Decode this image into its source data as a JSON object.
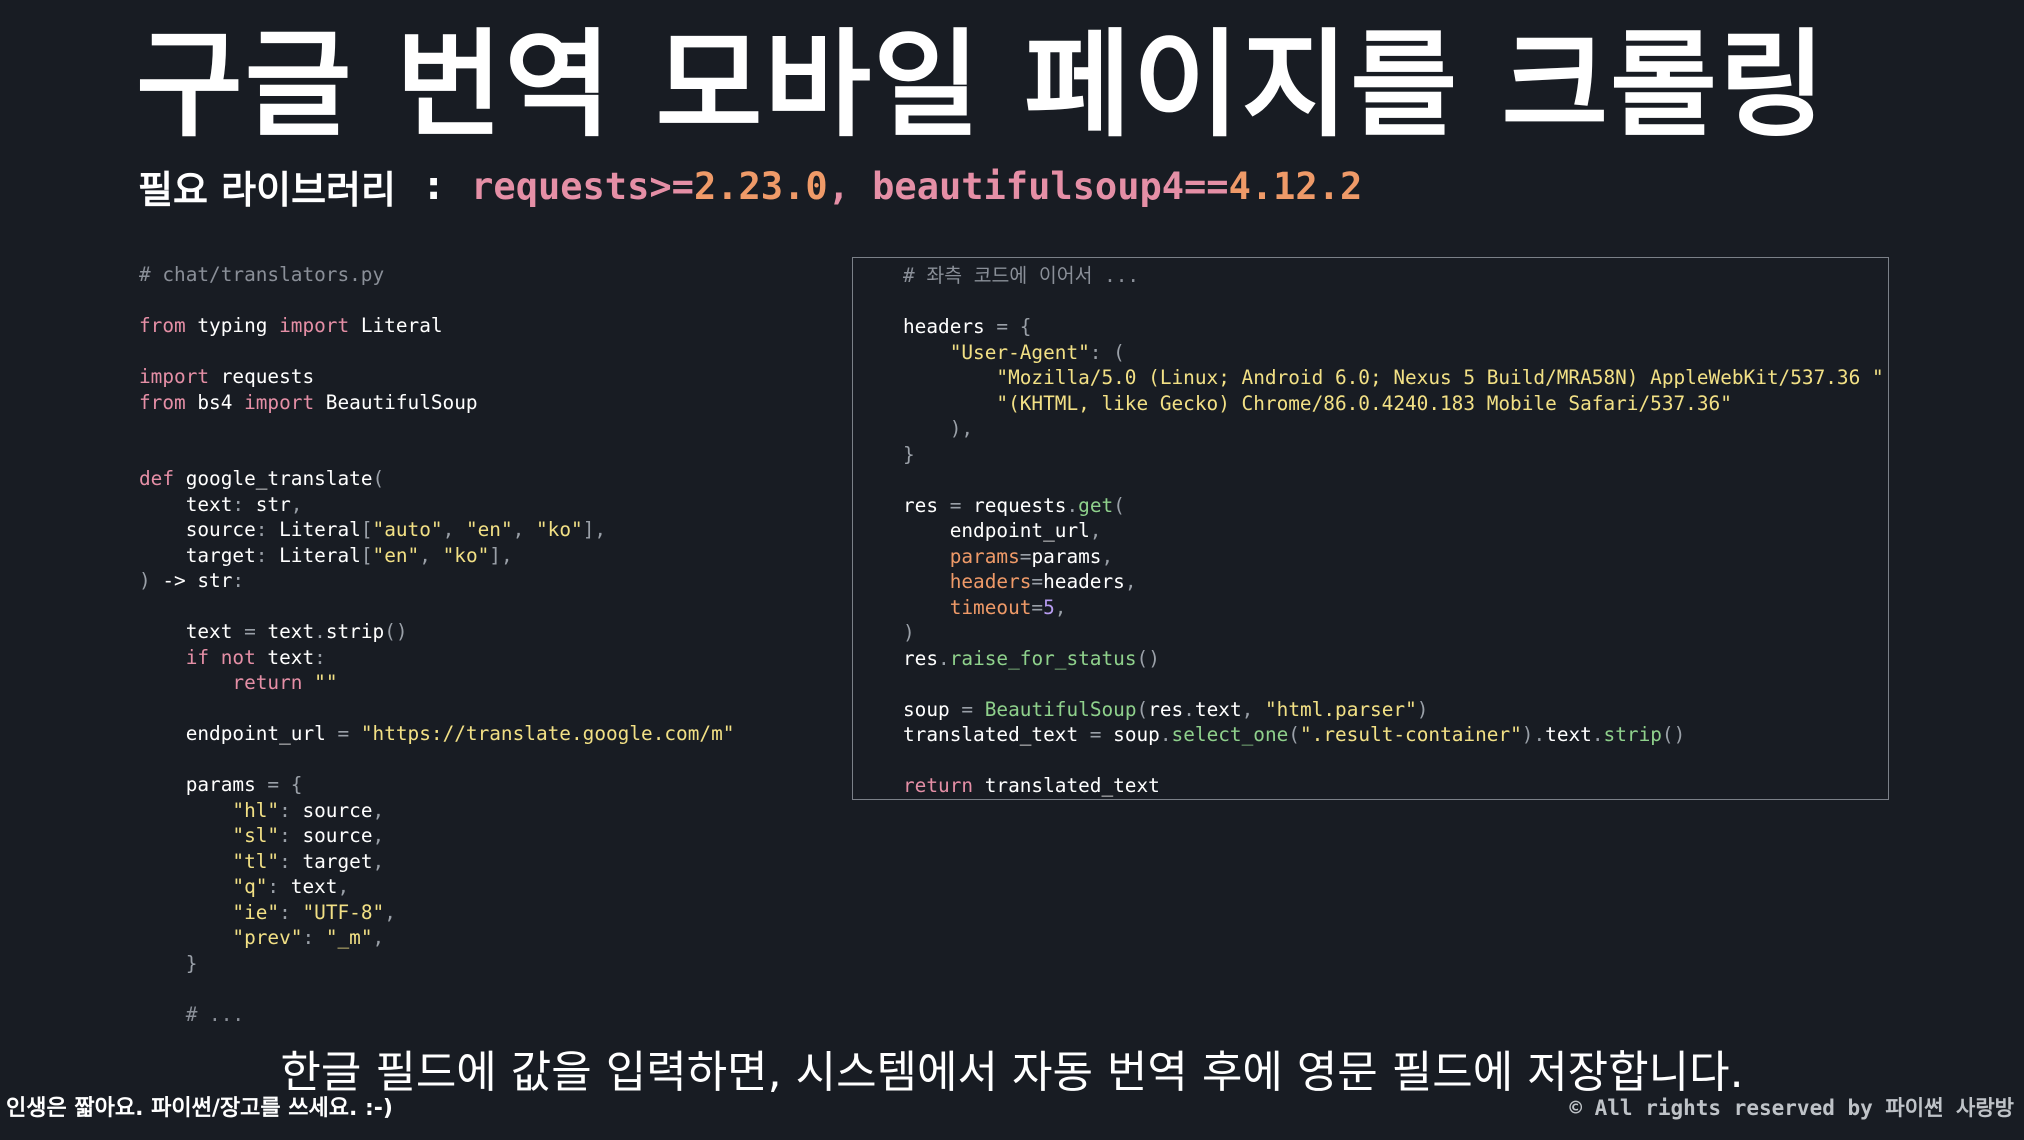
{
  "slide": {
    "title": "구글 번역 모바일 페이지를 크롤링",
    "subtitle_label": "필요 라이브러리",
    "subtitle_colon": ":",
    "libs": [
      {
        "name": "requests",
        "op": ">=",
        "version": "2.23.0",
        "sep": ", "
      },
      {
        "name": "beautifulsoup4",
        "op": "==",
        "version": "4.12.2",
        "sep": ""
      }
    ]
  },
  "code_left": [
    [
      [
        "c-cmt",
        "# chat/translators.py"
      ]
    ],
    [],
    [
      [
        "c-kw",
        "from"
      ],
      [
        "",
        " typing "
      ],
      [
        "c-kw",
        "import"
      ],
      [
        "",
        " Literal"
      ]
    ],
    [],
    [
      [
        "c-kw",
        "import"
      ],
      [
        "",
        " requests"
      ]
    ],
    [
      [
        "c-kw",
        "from"
      ],
      [
        "",
        " bs4 "
      ],
      [
        "c-kw",
        "import"
      ],
      [
        "",
        " BeautifulSoup"
      ]
    ],
    [],
    [],
    [
      [
        "c-kw",
        "def"
      ],
      [
        "",
        " google_translate"
      ],
      [
        "c-punc",
        "("
      ]
    ],
    [
      [
        "",
        "    text"
      ],
      [
        "c-punc",
        ":"
      ],
      [
        "",
        " str"
      ],
      [
        "c-punc",
        ","
      ]
    ],
    [
      [
        "",
        "    source"
      ],
      [
        "c-punc",
        ":"
      ],
      [
        "",
        " Literal"
      ],
      [
        "c-punc",
        "["
      ],
      [
        "c-str",
        "\"auto\""
      ],
      [
        "c-punc",
        ", "
      ],
      [
        "c-str",
        "\"en\""
      ],
      [
        "c-punc",
        ", "
      ],
      [
        "c-str",
        "\"ko\""
      ],
      [
        "c-punc",
        "],"
      ]
    ],
    [
      [
        "",
        "    target"
      ],
      [
        "c-punc",
        ":"
      ],
      [
        "",
        " Literal"
      ],
      [
        "c-punc",
        "["
      ],
      [
        "c-str",
        "\"en\""
      ],
      [
        "c-punc",
        ", "
      ],
      [
        "c-str",
        "\"ko\""
      ],
      [
        "c-punc",
        "],"
      ]
    ],
    [
      [
        "c-punc",
        ")"
      ],
      [
        "",
        " -> str"
      ],
      [
        "c-punc",
        ":"
      ]
    ],
    [],
    [
      [
        "",
        "    text "
      ],
      [
        "c-punc",
        "="
      ],
      [
        "",
        " text"
      ],
      [
        "c-punc",
        "."
      ],
      [
        "",
        "strip"
      ],
      [
        "c-punc",
        "()"
      ]
    ],
    [
      [
        "c-kw",
        "    if not"
      ],
      [
        "",
        " text"
      ],
      [
        "c-punc",
        ":"
      ]
    ],
    [
      [
        "c-kw",
        "        return"
      ],
      [
        "",
        " "
      ],
      [
        "c-str",
        "\"\""
      ]
    ],
    [],
    [
      [
        "",
        "    endpoint_url "
      ],
      [
        "c-punc",
        "="
      ],
      [
        "",
        " "
      ],
      [
        "c-str",
        "\"https://translate.google.com/m\""
      ]
    ],
    [],
    [
      [
        "",
        "    params "
      ],
      [
        "c-punc",
        "= {"
      ]
    ],
    [
      [
        "c-str",
        "        \"hl\""
      ],
      [
        "c-punc",
        ":"
      ],
      [
        "",
        " source"
      ],
      [
        "c-punc",
        ","
      ]
    ],
    [
      [
        "c-str",
        "        \"sl\""
      ],
      [
        "c-punc",
        ":"
      ],
      [
        "",
        " source"
      ],
      [
        "c-punc",
        ","
      ]
    ],
    [
      [
        "c-str",
        "        \"tl\""
      ],
      [
        "c-punc",
        ":"
      ],
      [
        "",
        " target"
      ],
      [
        "c-punc",
        ","
      ]
    ],
    [
      [
        "c-str",
        "        \"q\""
      ],
      [
        "c-punc",
        ":"
      ],
      [
        "",
        " text"
      ],
      [
        "c-punc",
        ","
      ]
    ],
    [
      [
        "c-str",
        "        \"ie\""
      ],
      [
        "c-punc",
        ":"
      ],
      [
        "",
        " "
      ],
      [
        "c-str",
        "\"UTF-8\""
      ],
      [
        "c-punc",
        ","
      ]
    ],
    [
      [
        "c-str",
        "        \"prev\""
      ],
      [
        "c-punc",
        ":"
      ],
      [
        "",
        " "
      ],
      [
        "c-str",
        "\"_m\""
      ],
      [
        "c-punc",
        ","
      ]
    ],
    [
      [
        "c-punc",
        "    }"
      ]
    ],
    [],
    [
      [
        "c-cmt",
        "    # ..."
      ]
    ]
  ],
  "code_right": [
    [
      [
        "c-cmt",
        "# 좌측 코드에 이어서 ..."
      ]
    ],
    [],
    [
      [
        "",
        "headers "
      ],
      [
        "c-punc",
        "= {"
      ]
    ],
    [
      [
        "c-str",
        "    \"User-Agent\""
      ],
      [
        "c-punc",
        ": ("
      ]
    ],
    [
      [
        "c-str",
        "        \"Mozilla/5.0 (Linux; Android 6.0; Nexus 5 Build/MRA58N) AppleWebKit/537.36 \""
      ]
    ],
    [
      [
        "c-str",
        "        \"(KHTML, like Gecko) Chrome/86.0.4240.183 Mobile Safari/537.36\""
      ]
    ],
    [
      [
        "c-punc",
        "    ),"
      ]
    ],
    [
      [
        "c-punc",
        "}"
      ]
    ],
    [],
    [
      [
        "",
        "res "
      ],
      [
        "c-punc",
        "="
      ],
      [
        "",
        " requests"
      ],
      [
        "c-punc",
        "."
      ],
      [
        "c-fn",
        "get"
      ],
      [
        "c-punc",
        "("
      ]
    ],
    [
      [
        "",
        "    endpoint_url"
      ],
      [
        "c-punc",
        ","
      ]
    ],
    [
      [
        "c-prm",
        "    params"
      ],
      [
        "c-punc",
        "="
      ],
      [
        "",
        "params"
      ],
      [
        "c-punc",
        ","
      ]
    ],
    [
      [
        "c-prm",
        "    headers"
      ],
      [
        "c-punc",
        "="
      ],
      [
        "",
        "headers"
      ],
      [
        "c-punc",
        ","
      ]
    ],
    [
      [
        "c-prm",
        "    timeout"
      ],
      [
        "c-punc",
        "="
      ],
      [
        "c-num",
        "5"
      ],
      [
        "c-punc",
        ","
      ]
    ],
    [
      [
        "c-punc",
        ")"
      ]
    ],
    [
      [
        "",
        "res"
      ],
      [
        "c-punc",
        "."
      ],
      [
        "c-fn",
        "raise_for_status"
      ],
      [
        "c-punc",
        "()"
      ]
    ],
    [],
    [
      [
        "",
        "soup "
      ],
      [
        "c-punc",
        "="
      ],
      [
        "",
        " "
      ],
      [
        "c-fn",
        "BeautifulSoup"
      ],
      [
        "c-punc",
        "("
      ],
      [
        "",
        "res"
      ],
      [
        "c-punc",
        "."
      ],
      [
        "",
        "text"
      ],
      [
        "c-punc",
        ", "
      ],
      [
        "c-str",
        "\"html.parser\""
      ],
      [
        "c-punc",
        ")"
      ]
    ],
    [
      [
        "",
        "translated_text "
      ],
      [
        "c-punc",
        "="
      ],
      [
        "",
        " soup"
      ],
      [
        "c-punc",
        "."
      ],
      [
        "c-fn",
        "select_one"
      ],
      [
        "c-punc",
        "("
      ],
      [
        "c-str",
        "\".result-container\""
      ],
      [
        "c-punc",
        ")."
      ],
      [
        "",
        "text"
      ],
      [
        "c-punc",
        "."
      ],
      [
        "c-fn",
        "strip"
      ],
      [
        "c-punc",
        "()"
      ]
    ],
    [],
    [
      [
        "c-kw",
        "return"
      ],
      [
        "",
        " translated_text"
      ]
    ]
  ],
  "caption": "한글 필드에 값을 입력하면, 시스템에서 자동 번역 후에 영문 필드에 저장합니다.",
  "footer": {
    "left": "인생은 짧아요. 파이썬/장고를 쓰세요. :-)",
    "right": "© All rights reserved by 파이썬 사랑방"
  }
}
